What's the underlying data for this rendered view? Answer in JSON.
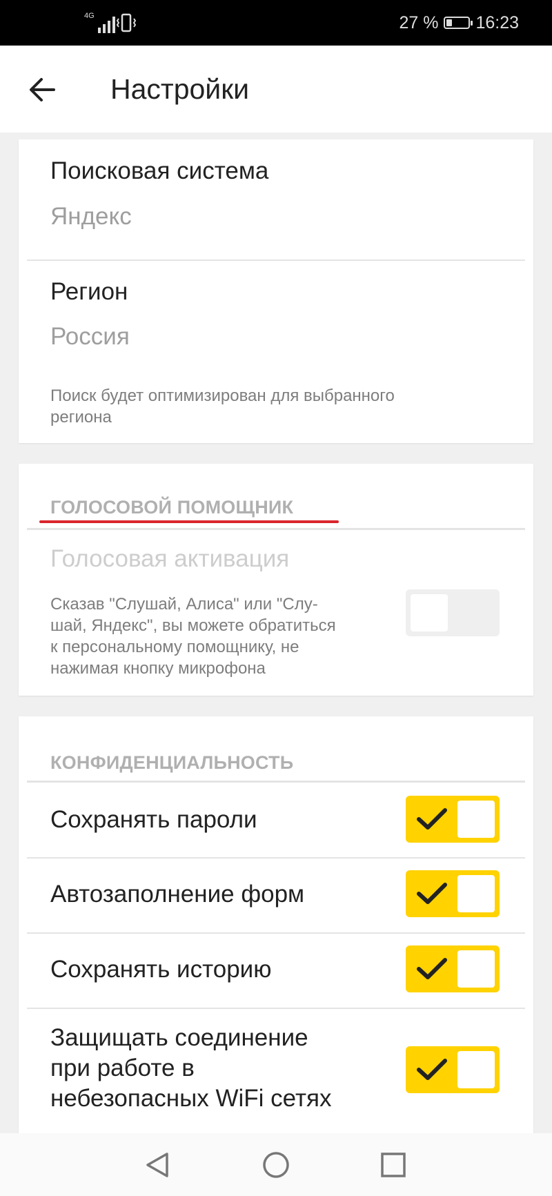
{
  "status_bar": {
    "network": "4G",
    "battery_percent": "27 %",
    "battery_level": 0.27,
    "time": "16:23"
  },
  "header": {
    "title": "Настройки",
    "back_icon": "arrow-left-icon"
  },
  "search_card": {
    "search_engine": {
      "title": "Поисковая система",
      "value": "Яндекс"
    },
    "region": {
      "title": "Регион",
      "value": "Россия",
      "hint_line1": "Поиск будет оптимизирован для выбранного",
      "hint_line2": "региона"
    }
  },
  "voice_card": {
    "section_title": "ГОЛОСОВОЙ ПОМОЩНИК",
    "voice_activation": {
      "title": "Голосовая активация",
      "hint_line1": "Сказав \"Слушай, Алиса\" или \"Слу-",
      "hint_line2": "шай, Яндекс\", вы можете обратиться",
      "hint_line3": "к персональному помощнику, не",
      "hint_line4": "нажимая кнопку микрофона",
      "enabled": false
    }
  },
  "privacy_card": {
    "section_title": "КОНФИДЕНЦИАЛЬНОСТЬ",
    "items": [
      {
        "label": "Сохранять пароли",
        "enabled": true
      },
      {
        "label": "Автозаполнение форм",
        "enabled": true
      },
      {
        "label": "Сохранять историю",
        "enabled": true
      },
      {
        "label_line1": "Защищать соединение",
        "label_line2": "при работе в",
        "label_line3": "небезопасных WiFi сетях",
        "enabled": true
      }
    ]
  },
  "nav_bar": {
    "back": "triangle-back-icon",
    "home": "circle-home-icon",
    "recents": "square-recents-icon"
  },
  "colors": {
    "accent_toggle": "#ffd200",
    "annotation_underline": "#d9262c"
  }
}
